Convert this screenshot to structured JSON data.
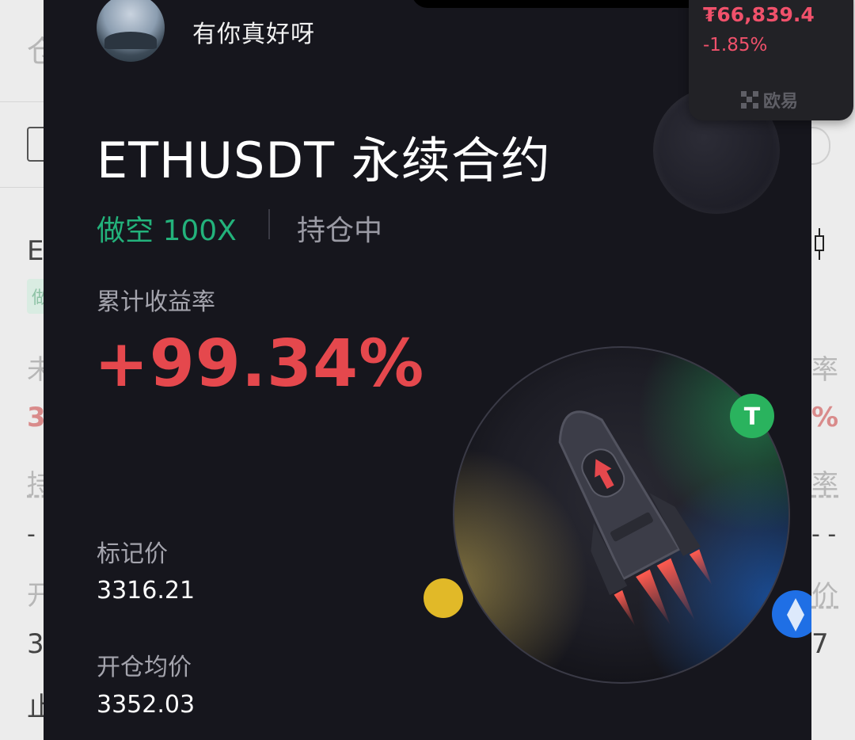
{
  "background_app": {
    "fragments": [
      "仓",
      "E",
      "做",
      "未",
      "3",
      "持",
      "- -",
      "开",
      "3",
      "止",
      "率",
      "%",
      "率",
      "- -",
      "价",
      "7"
    ],
    "accent_colors": {
      "loss": "#d98b8b",
      "long": "#8fc3a6"
    }
  },
  "card": {
    "username": "有你真好呀",
    "title": "ETHUSDT 永续合约",
    "direction": "做空 100X",
    "status": "持仓中",
    "pnl_label": "累计收益率",
    "pnl_value": "+99.34%",
    "mark_price_label": "标记价",
    "mark_price_value": "3316.21",
    "open_price_label": "开仓均价",
    "open_price_value": "3352.03",
    "colors": {
      "background": "#16161d",
      "short": "#23b27b",
      "profit": "#e5484d"
    },
    "illustration": "rocket-in-orb-illustration"
  },
  "ticker": {
    "price": "₮66,839.4",
    "change": "-1.85%",
    "brand": "欧易",
    "color": "#f0516b"
  }
}
